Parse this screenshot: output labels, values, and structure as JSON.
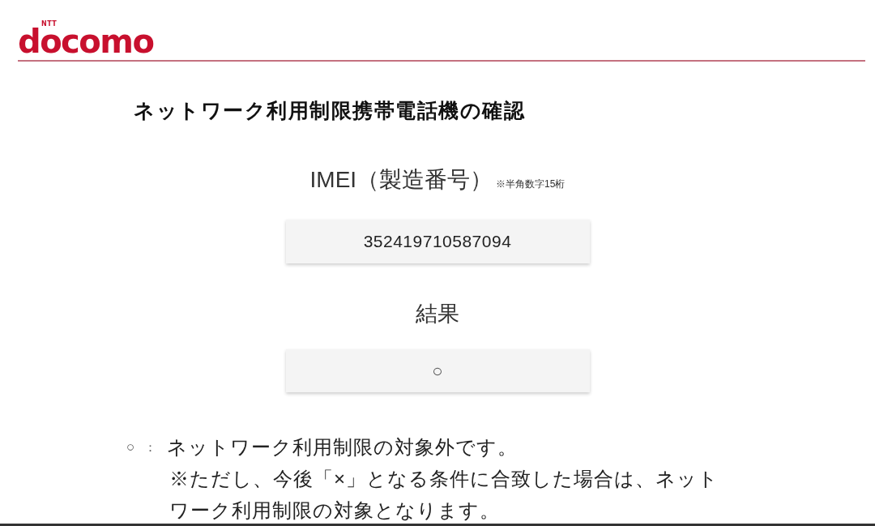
{
  "header": {
    "logo": {
      "brand_small": "NTT",
      "brand": "docomo"
    }
  },
  "page_title": "ネットワーク利用制限携帯電話機の確認",
  "imei": {
    "label": "IMEI（製造番号）",
    "note": "※半角数字15桁",
    "value": "352419710587094"
  },
  "result": {
    "label": "結果",
    "value": "○"
  },
  "legend": [
    {
      "symbol": "○",
      "separator": "：",
      "text": "ネットワーク利用制限の対象外です。",
      "note": "※ただし、今後「×」となる条件に合致した場合は、ネットワーク利用制限の対象となります。"
    }
  ]
}
